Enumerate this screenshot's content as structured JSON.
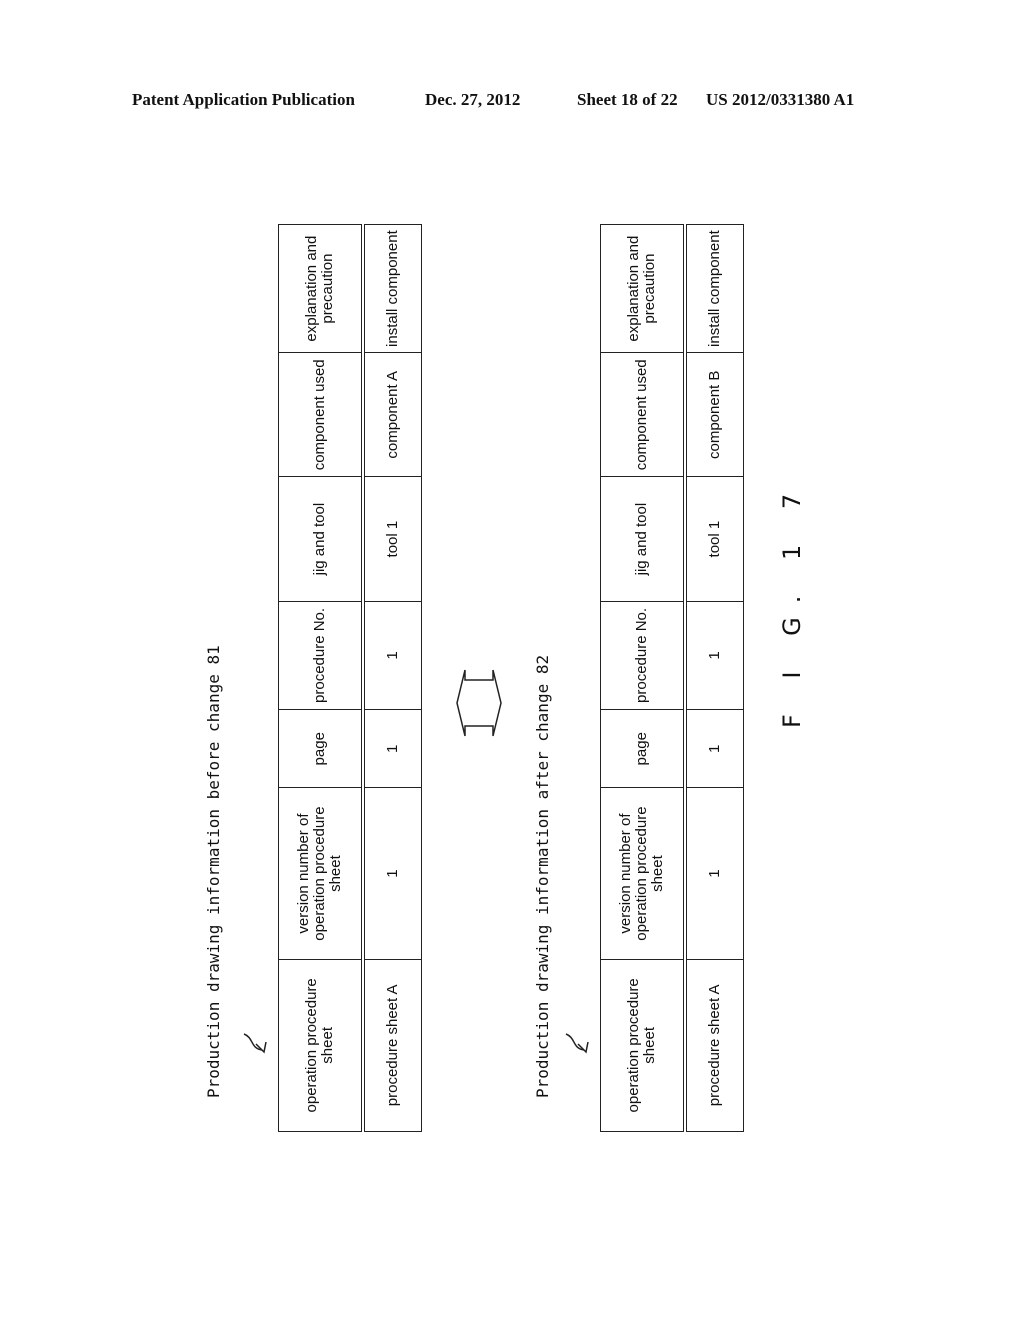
{
  "header": {
    "publication": "Patent Application Publication",
    "date": "Dec. 27, 2012",
    "sheet": "Sheet 18 of 22",
    "number": "US 2012/0331380 A1"
  },
  "tables": [
    {
      "caption": "Production drawing information before change 81",
      "columns": [
        "operation procedure sheet",
        "version number of operation procedure sheet",
        "page",
        "procedure No.",
        "jig and tool",
        "component used",
        "explanation and precaution"
      ],
      "row": [
        "procedure sheet A",
        "1",
        "1",
        "1",
        "tool 1",
        "component A",
        "install component"
      ]
    },
    {
      "caption": "Production drawing information after change 82",
      "columns": [
        "operation procedure sheet",
        "version number of operation procedure sheet",
        "page",
        "procedure No.",
        "jig and tool",
        "component used",
        "explanation and precaution"
      ],
      "row": [
        "procedure sheet A",
        "1",
        "1",
        "1",
        "tool 1",
        "component B",
        "install component"
      ]
    }
  ],
  "figure_label": "F I G. 1 7",
  "icons": {
    "comparison": "double-arrow-icon",
    "leader": "leader-arrow-icon"
  }
}
